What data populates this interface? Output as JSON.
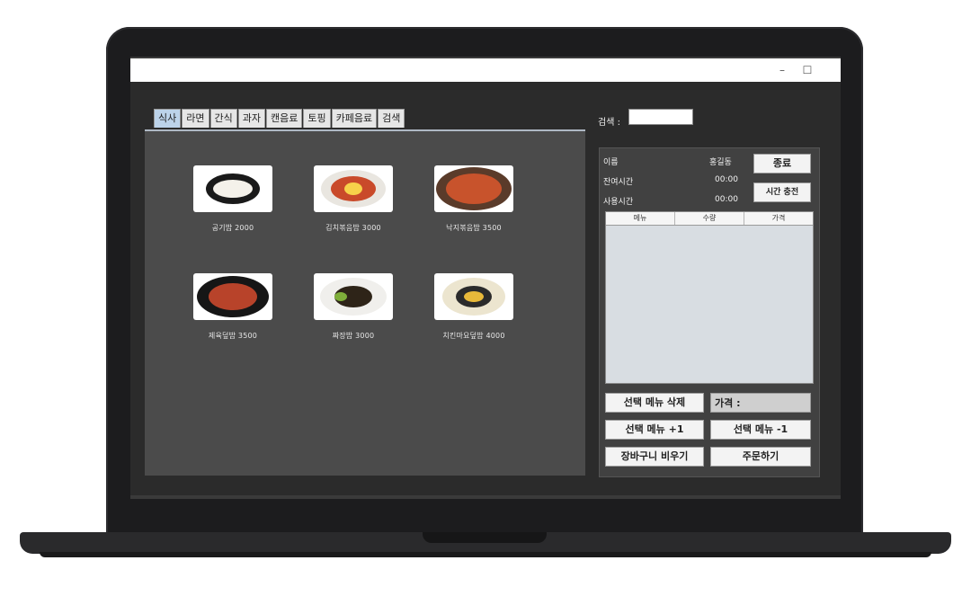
{
  "window": {
    "minimize_glyph": "–",
    "maximize_glyph": "☐"
  },
  "tabs": [
    "식사",
    "라면",
    "간식",
    "과자",
    "캔음료",
    "토핑",
    "카페음료",
    "검색"
  ],
  "menu_items": [
    {
      "label": "공기밥 2000",
      "image": "rice-bowl"
    },
    {
      "label": "김치볶음밥 3000",
      "image": "kimchi-fried-rice"
    },
    {
      "label": "낙지볶음밥 3500",
      "image": "octopus-fried-rice"
    },
    {
      "label": "제육덮밥 3500",
      "image": "pork-rice-bowl"
    },
    {
      "label": "짜장밥 3000",
      "image": "jjajang-rice"
    },
    {
      "label": "치킨마요덮밥 4000",
      "image": "chicken-mayo-rice"
    }
  ],
  "search": {
    "label": "검색 :",
    "value": ""
  },
  "user": {
    "name_label": "이름",
    "name_value": "홍길동",
    "remaining_label": "잔여시간",
    "remaining_value": "00:00",
    "used_label": "사용시간",
    "used_value": "00:00"
  },
  "buttons": {
    "exit": "종료",
    "charge_time": "시간 충전",
    "delete_selected": "선택 메뉴 삭제",
    "plus_one": "선택 메뉴 +1",
    "minus_one": "선택 메뉴 -1",
    "clear_cart": "장바구니 비우기",
    "order": "주문하기"
  },
  "cart_table": {
    "columns": [
      "메뉴",
      "수량",
      "가격"
    ],
    "rows": []
  },
  "price": {
    "label": "가격 :"
  },
  "colors": {
    "active_tab": "#bcd3ea",
    "panel": "#4b4b4b",
    "background": "#2b2b2b"
  }
}
